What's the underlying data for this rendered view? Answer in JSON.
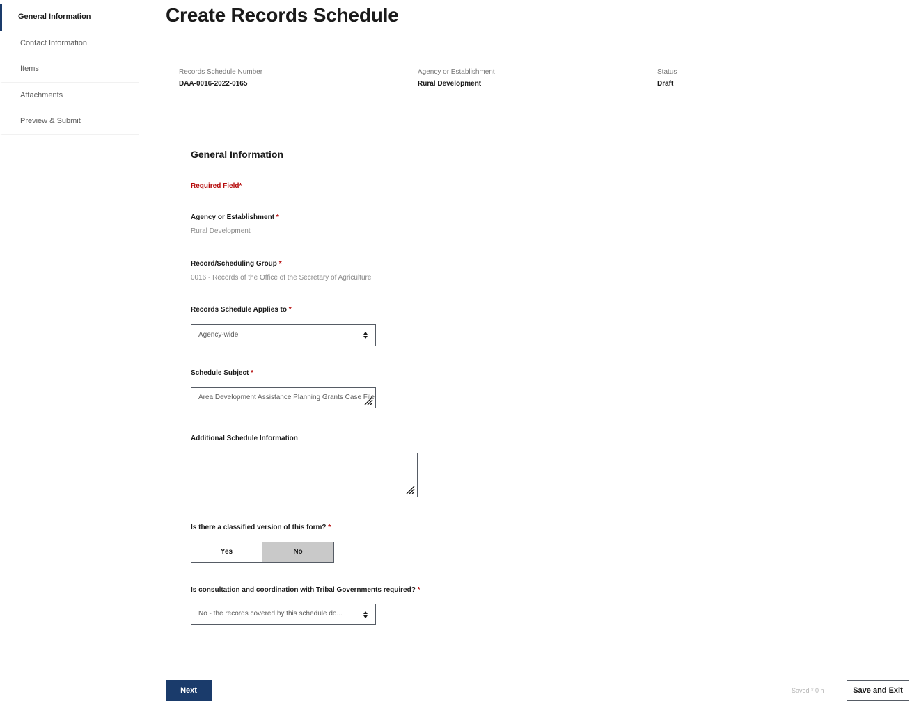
{
  "sidebar": {
    "items": [
      {
        "label": "General Information",
        "active": true
      },
      {
        "label": "Contact Information",
        "active": false
      },
      {
        "label": "Items",
        "active": false
      },
      {
        "label": "Attachments",
        "active": false
      },
      {
        "label": "Preview & Submit",
        "active": false
      }
    ]
  },
  "page": {
    "title": "Create Records Schedule"
  },
  "summary": {
    "number_label": "Records Schedule Number",
    "number_value": "DAA-0016-2022-0165",
    "agency_label": "Agency or Establishment",
    "agency_value": "Rural Development",
    "status_label": "Status",
    "status_value": "Draft"
  },
  "form": {
    "section_title": "General Information",
    "required_note": "Required Field*",
    "required_marker": "*",
    "agency": {
      "label": "Agency or Establishment",
      "value": "Rural Development"
    },
    "group": {
      "label": "Record/Scheduling Group",
      "value": "0016 - Records of the Office of the Secretary of Agriculture"
    },
    "applies_to": {
      "label": "Records Schedule Applies to",
      "value": "Agency-wide"
    },
    "subject": {
      "label": "Schedule Subject",
      "value": "Area Development Assistance Planning Grants Case Files"
    },
    "additional": {
      "label": "Additional Schedule Information",
      "value": ""
    },
    "classified": {
      "label": "Is there a classified version of this form?",
      "yes": "Yes",
      "no": "No",
      "selected": "No"
    },
    "tribal": {
      "label": "Is consultation and coordination with Tribal Governments required?",
      "value": "No - the records covered by this schedule do..."
    }
  },
  "footer": {
    "next_label": "Next",
    "draft_status": "Saved * 0 h",
    "save_exit_label": "Save and Exit"
  },
  "colors": {
    "primary": "#1a3b6b",
    "required": "#b50909",
    "selected_toggle": "#c9c9c9"
  },
  "icons": {
    "select_caret": "sort-caret-icon",
    "resize_grip": "resize-grip-icon"
  }
}
